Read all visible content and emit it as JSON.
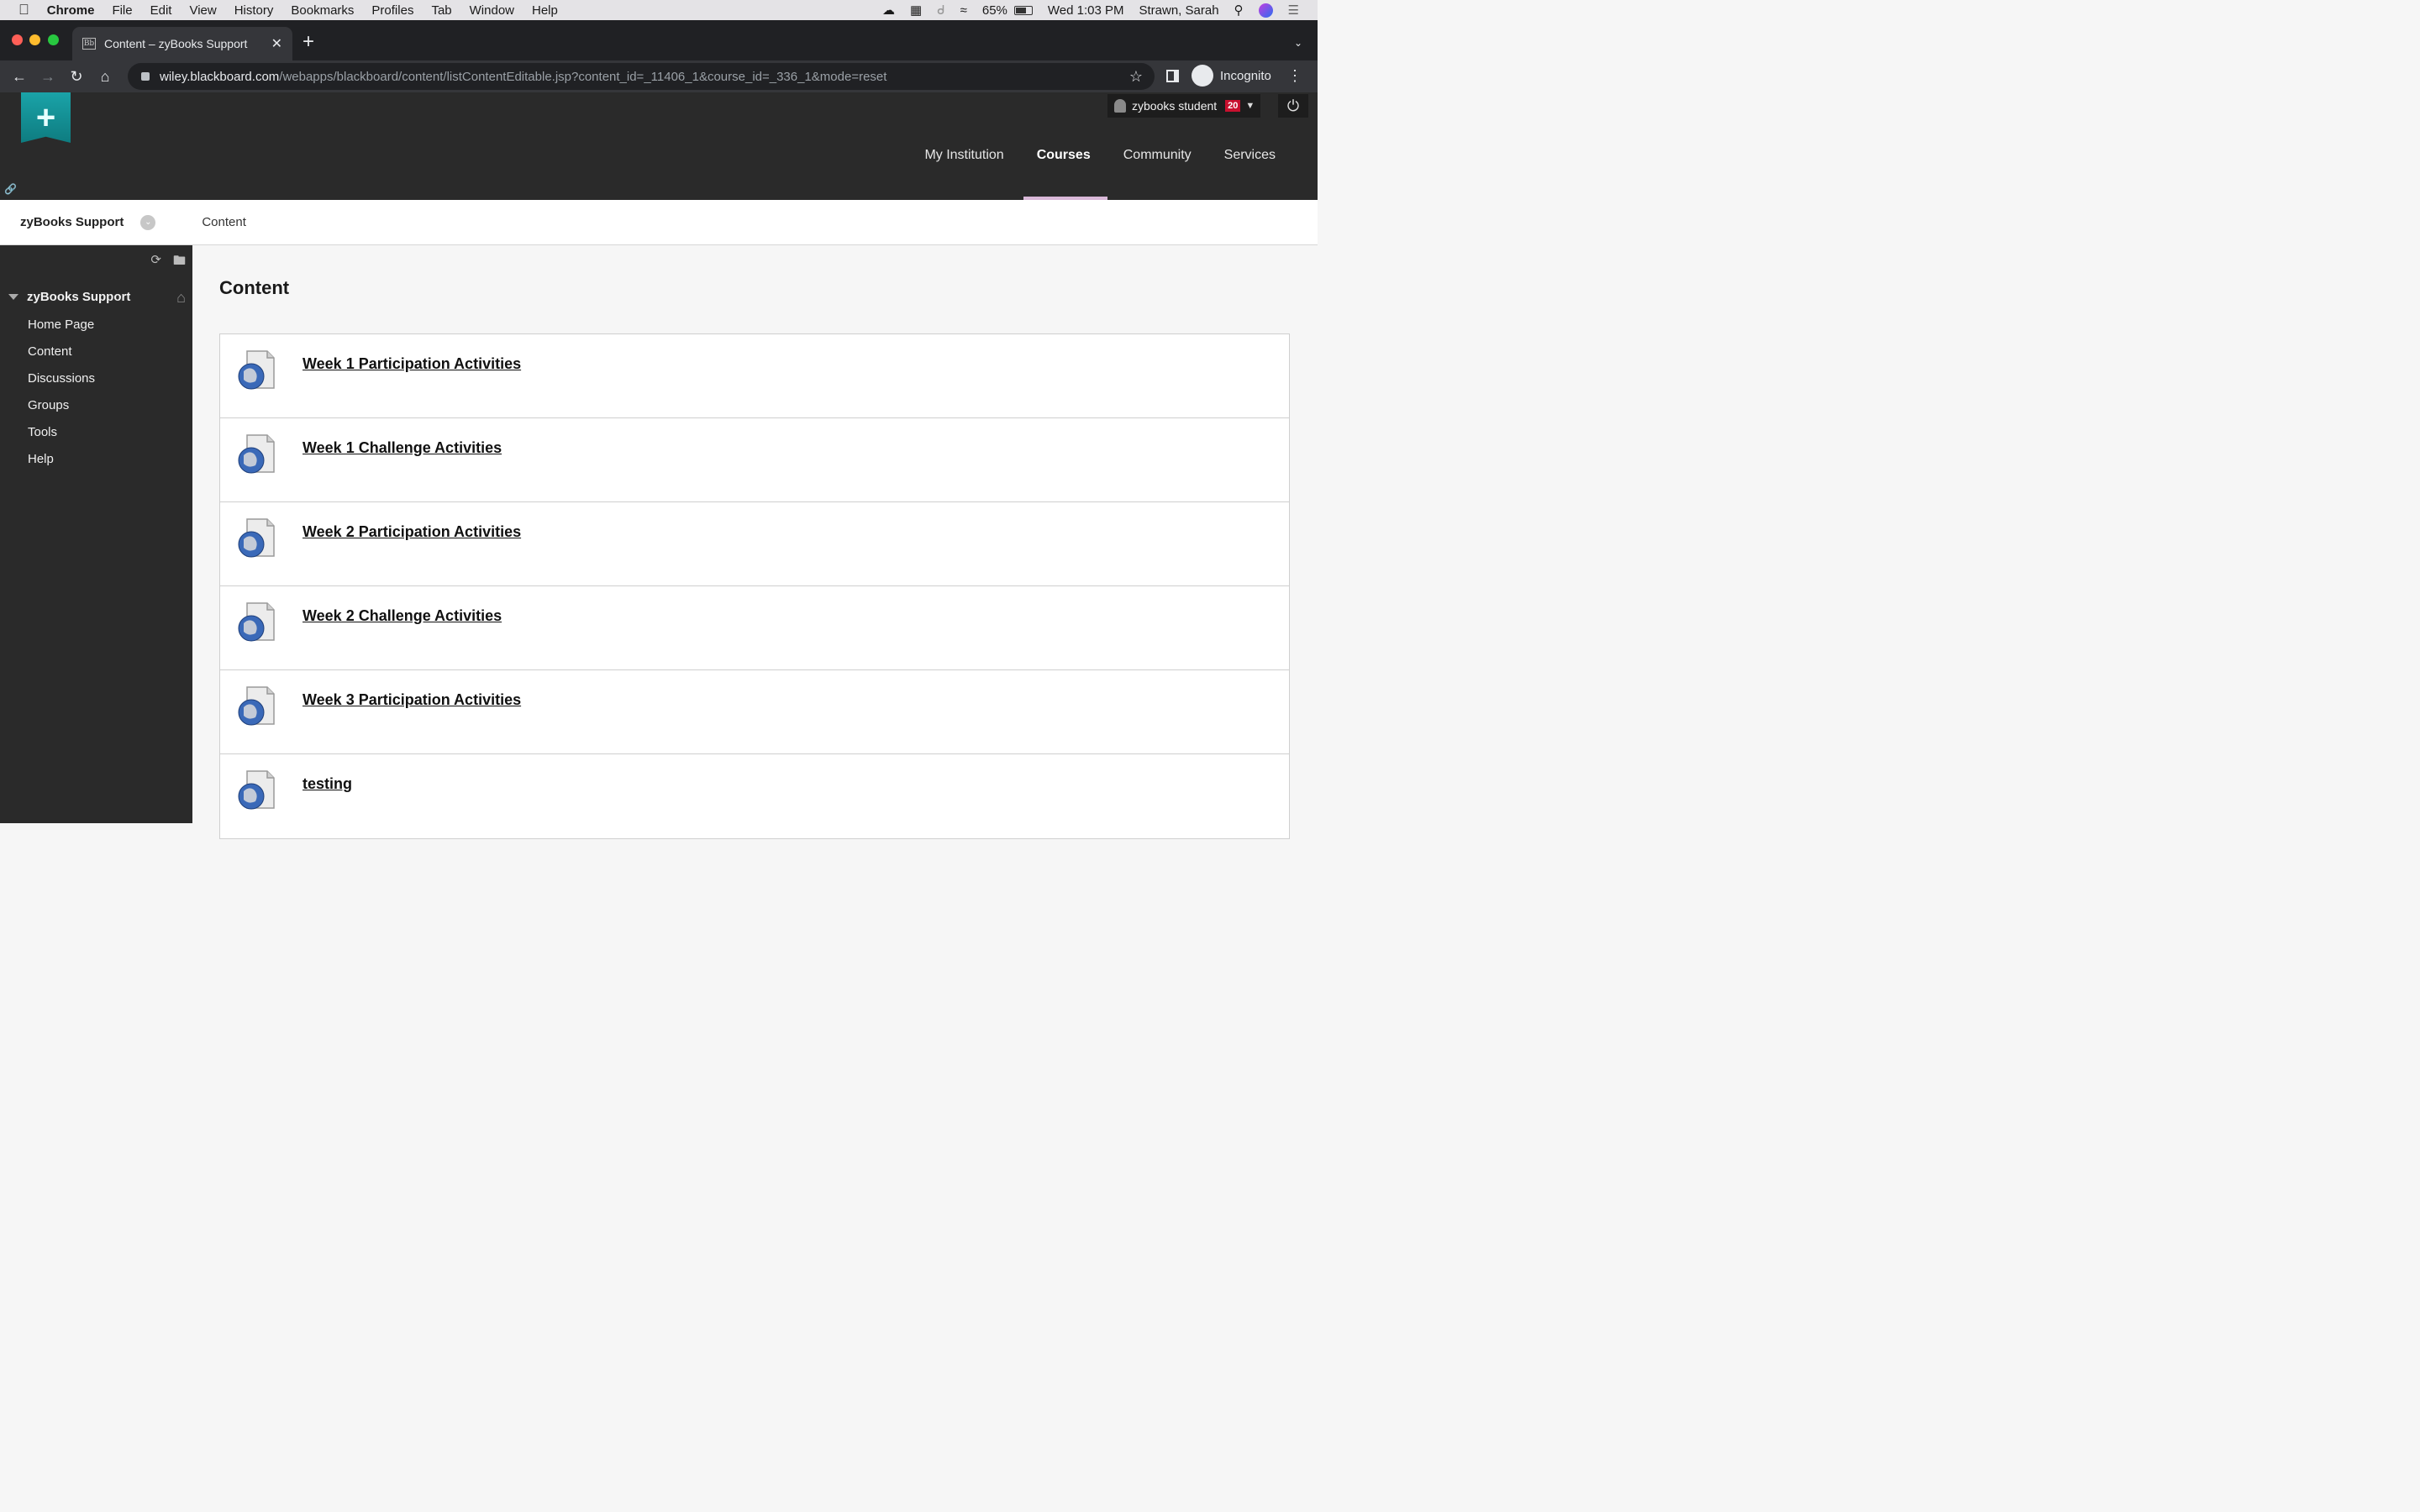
{
  "mac_menu": {
    "app": "Chrome",
    "items": [
      "File",
      "Edit",
      "View",
      "History",
      "Bookmarks",
      "Profiles",
      "Tab",
      "Window",
      "Help"
    ],
    "battery": "65%",
    "clock": "Wed 1:03 PM",
    "user": "Strawn, Sarah"
  },
  "browser": {
    "tab_title": "Content – zyBooks Support",
    "tab_favicon": "Bb",
    "url_host": "wiley.blackboard.com",
    "url_path": "/webapps/blackboard/content/listContentEditable.jsp?content_id=_11406_1&course_id=_336_1&mode=reset",
    "profile_label": "Incognito"
  },
  "header": {
    "user_name": "zybooks student",
    "notification_count": "20",
    "nav": [
      "My Institution",
      "Courses",
      "Community",
      "Services"
    ],
    "active_nav": "Courses"
  },
  "breadcrumb": {
    "course": "zyBooks Support",
    "page": "Content"
  },
  "course_menu": {
    "title": "zyBooks Support",
    "items": [
      "Home Page",
      "Content",
      "Discussions",
      "Groups",
      "Tools",
      "Help"
    ]
  },
  "main": {
    "title": "Content",
    "items": [
      "Week 1 Participation Activities",
      "Week 1 Challenge Activities",
      "Week 2 Participation Activities",
      "Week 2 Challenge Activities",
      "Week 3 Participation Activities",
      "testing"
    ]
  },
  "colors": {
    "accent_teal": "#1aa3a8",
    "header_bg": "#2a2a2a",
    "badge_red": "#c8102e"
  }
}
